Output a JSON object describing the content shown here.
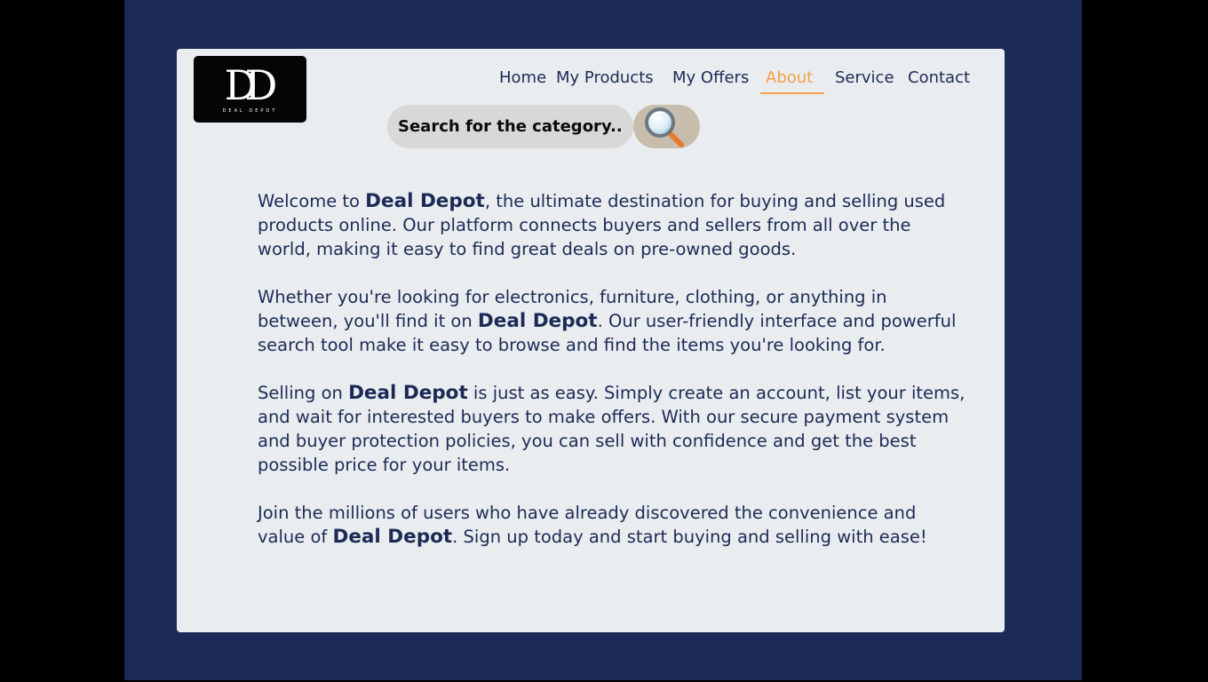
{
  "colors": {
    "frame": "#000000",
    "backdrop": "#1b2a57",
    "card": "#eaedef",
    "text": "#1b2a57",
    "accent": "#f5a04a",
    "search_field": "#d8d8d8",
    "search_button": "#c8bcac"
  },
  "logo": {
    "mark": "DD",
    "name": "DEAL DEPOT"
  },
  "nav": {
    "items": [
      "Home",
      "My Products",
      "My Offers",
      "About",
      "Service",
      "Contact"
    ],
    "active": "About"
  },
  "search": {
    "placeholder": "Search for the category..",
    "button_icon": "magnifying-glass-icon"
  },
  "about": {
    "brand": "Deal Depot",
    "p1": {
      "a": "Welcome to ",
      "b": ", the ultimate destination for buying and selling used products online. Our platform connects buyers and sellers from all over the world, making it easy to find great deals on pre-owned goods."
    },
    "p2": {
      "a": " Whether you're looking for electronics, furniture, clothing, or anything in between, you'll find it on ",
      "b": ". Our user-friendly interface and powerful search tool make it easy to browse and find the items you're looking for."
    },
    "p3": {
      "a": " Selling on ",
      "b": " is just as easy. Simply create an account, list your items, and wait for interested buyers to make offers. With our secure payment system and buyer protection policies, you can sell with confidence and get the best possible price for your items."
    },
    "p4": {
      "a": " Join the millions of users who have already discovered the convenience and value of ",
      "b": ". Sign up today and start buying and selling with ease!"
    }
  }
}
